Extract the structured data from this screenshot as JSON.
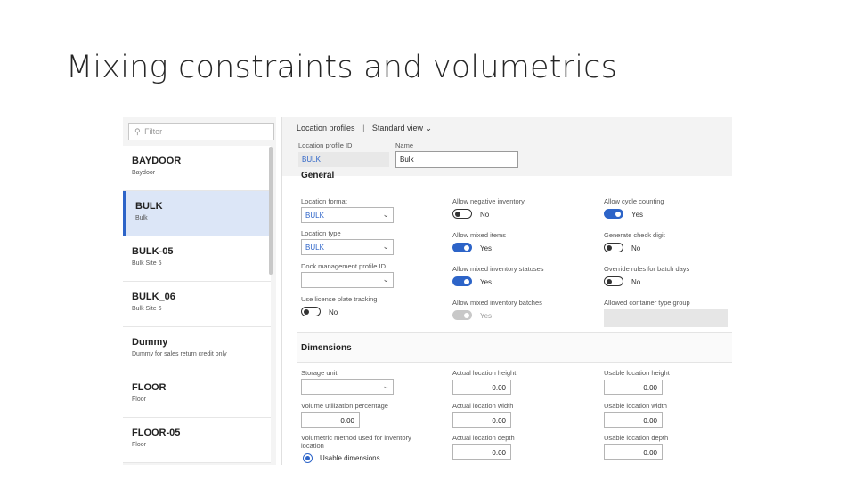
{
  "slide": {
    "title": "Mixing constraints and volumetrics"
  },
  "list": {
    "filter_placeholder": "Filter",
    "records": [
      {
        "id": "BAYDOOR",
        "name": "Baydoor",
        "selected": false
      },
      {
        "id": "BULK",
        "name": "Bulk",
        "selected": true
      },
      {
        "id": "BULK-05",
        "name": "Bulk Site 5",
        "selected": false
      },
      {
        "id": "BULK_06",
        "name": "Bulk Site 6",
        "selected": false
      },
      {
        "id": "Dummy",
        "name": "Dummy for sales return credit only",
        "selected": false
      },
      {
        "id": "FLOOR",
        "name": "Floor",
        "selected": false
      },
      {
        "id": "FLOOR-05",
        "name": "Floor",
        "selected": false
      }
    ]
  },
  "header": {
    "breadcrumb_page": "Location profiles",
    "breadcrumb_sep": "|",
    "breadcrumb_view": "Standard view",
    "id_label": "Location profile ID",
    "id_value": "BULK",
    "name_label": "Name",
    "name_value": "Bulk"
  },
  "general": {
    "title": "General",
    "location_format": {
      "label": "Location format",
      "value": "BULK"
    },
    "location_type": {
      "label": "Location type",
      "value": "BULK"
    },
    "dock_mgmt": {
      "label": "Dock management profile ID",
      "value": ""
    },
    "license_plate": {
      "label": "Use license plate tracking",
      "value": "No",
      "on": false
    },
    "allow_negative": {
      "label": "Allow negative inventory",
      "value": "No",
      "on": false
    },
    "allow_mixed_items": {
      "label": "Allow mixed items",
      "value": "Yes",
      "on": true
    },
    "allow_mixed_statuses": {
      "label": "Allow mixed inventory statuses",
      "value": "Yes",
      "on": true
    },
    "allow_mixed_batches": {
      "label": "Allow mixed inventory batches",
      "value": "Yes",
      "on": true,
      "disabled": true
    },
    "allow_cycle_counting": {
      "label": "Allow cycle counting",
      "value": "Yes",
      "on": true
    },
    "generate_check_digit": {
      "label": "Generate check digit",
      "value": "No",
      "on": false
    },
    "override_batch_days": {
      "label": "Override rules for batch days",
      "value": "No",
      "on": false
    },
    "allowed_container_group": {
      "label": "Allowed container type group",
      "value": ""
    }
  },
  "dimensions": {
    "title": "Dimensions",
    "storage_unit": {
      "label": "Storage unit",
      "value": ""
    },
    "volume_util": {
      "label": "Volume utilization percentage",
      "value": "0.00"
    },
    "volumetric_method": {
      "label": "Volumetric method used for inventory location",
      "value": "Usable dimensions"
    },
    "actual_height": {
      "label": "Actual location height",
      "value": "0.00"
    },
    "actual_width": {
      "label": "Actual location width",
      "value": "0.00"
    },
    "actual_depth": {
      "label": "Actual location depth",
      "value": "0.00"
    },
    "usable_height": {
      "label": "Usable location height",
      "value": "0.00"
    },
    "usable_width": {
      "label": "Usable location width",
      "value": "0.00"
    },
    "usable_depth": {
      "label": "Usable location depth",
      "value": "0.00"
    }
  },
  "icons": {
    "filter": "search-icon",
    "chevron": "chevron-down-icon"
  },
  "colors": {
    "accent": "#2d64c8",
    "selected_row": "#dce6f7"
  }
}
